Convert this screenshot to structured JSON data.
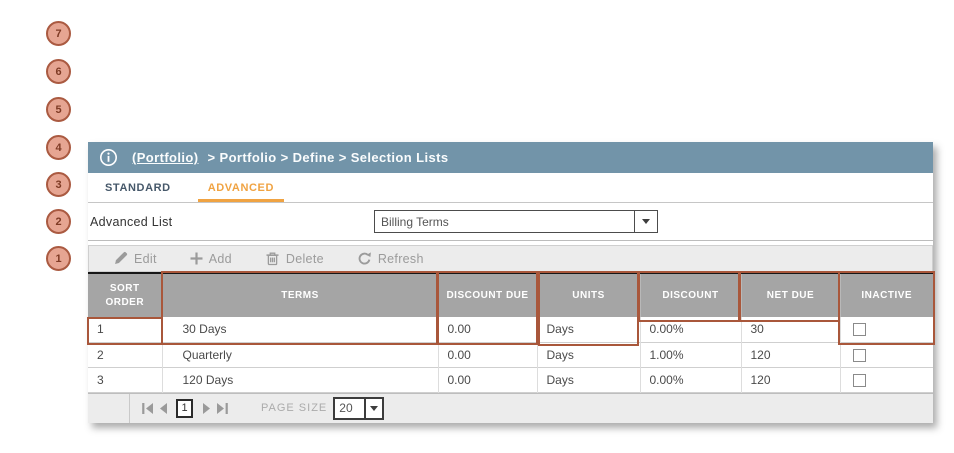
{
  "colors": {
    "titlebar_bg": "#7294a9",
    "active_tab_orange": "#f0a342",
    "annotation_accent": "#a9573b",
    "annotation_circle_fill": "#e6a592",
    "grid_header_bg": "#a5a5a5"
  },
  "annotations": {
    "circles": [
      "7",
      "6",
      "5",
      "4",
      "3",
      "2",
      "1"
    ]
  },
  "breadcrumb_bar": {
    "link": "(Portfolio)",
    "trail": "> Portfolio > Define > Selection Lists"
  },
  "tabs": {
    "standard": "STANDARD",
    "advanced": "ADVANCED"
  },
  "filter": {
    "label": "Advanced List",
    "value": "Billing Terms"
  },
  "toolbar": {
    "edit": "Edit",
    "add": "Add",
    "delete": "Delete",
    "refresh": "Refresh"
  },
  "table": {
    "columns": [
      "SORT ORDER",
      "TERMS",
      "DISCOUNT DUE",
      "UNITS",
      "DISCOUNT",
      "NET DUE",
      "INACTIVE"
    ],
    "rows": [
      {
        "sort_order": "1",
        "terms": "30 Days",
        "discount_due": "0.00",
        "units": "Days",
        "discount": "0.00%",
        "net_due": "30",
        "inactive": false
      },
      {
        "sort_order": "2",
        "terms": "Quarterly",
        "discount_due": "0.00",
        "units": "Days",
        "discount": "1.00%",
        "net_due": "120",
        "inactive": false
      },
      {
        "sort_order": "3",
        "terms": "120 Days",
        "discount_due": "0.00",
        "units": "Days",
        "discount": "0.00%",
        "net_due": "120",
        "inactive": false
      }
    ]
  },
  "pagination": {
    "page": "1",
    "page_size_label": "PAGE SIZE",
    "page_size": "20"
  }
}
